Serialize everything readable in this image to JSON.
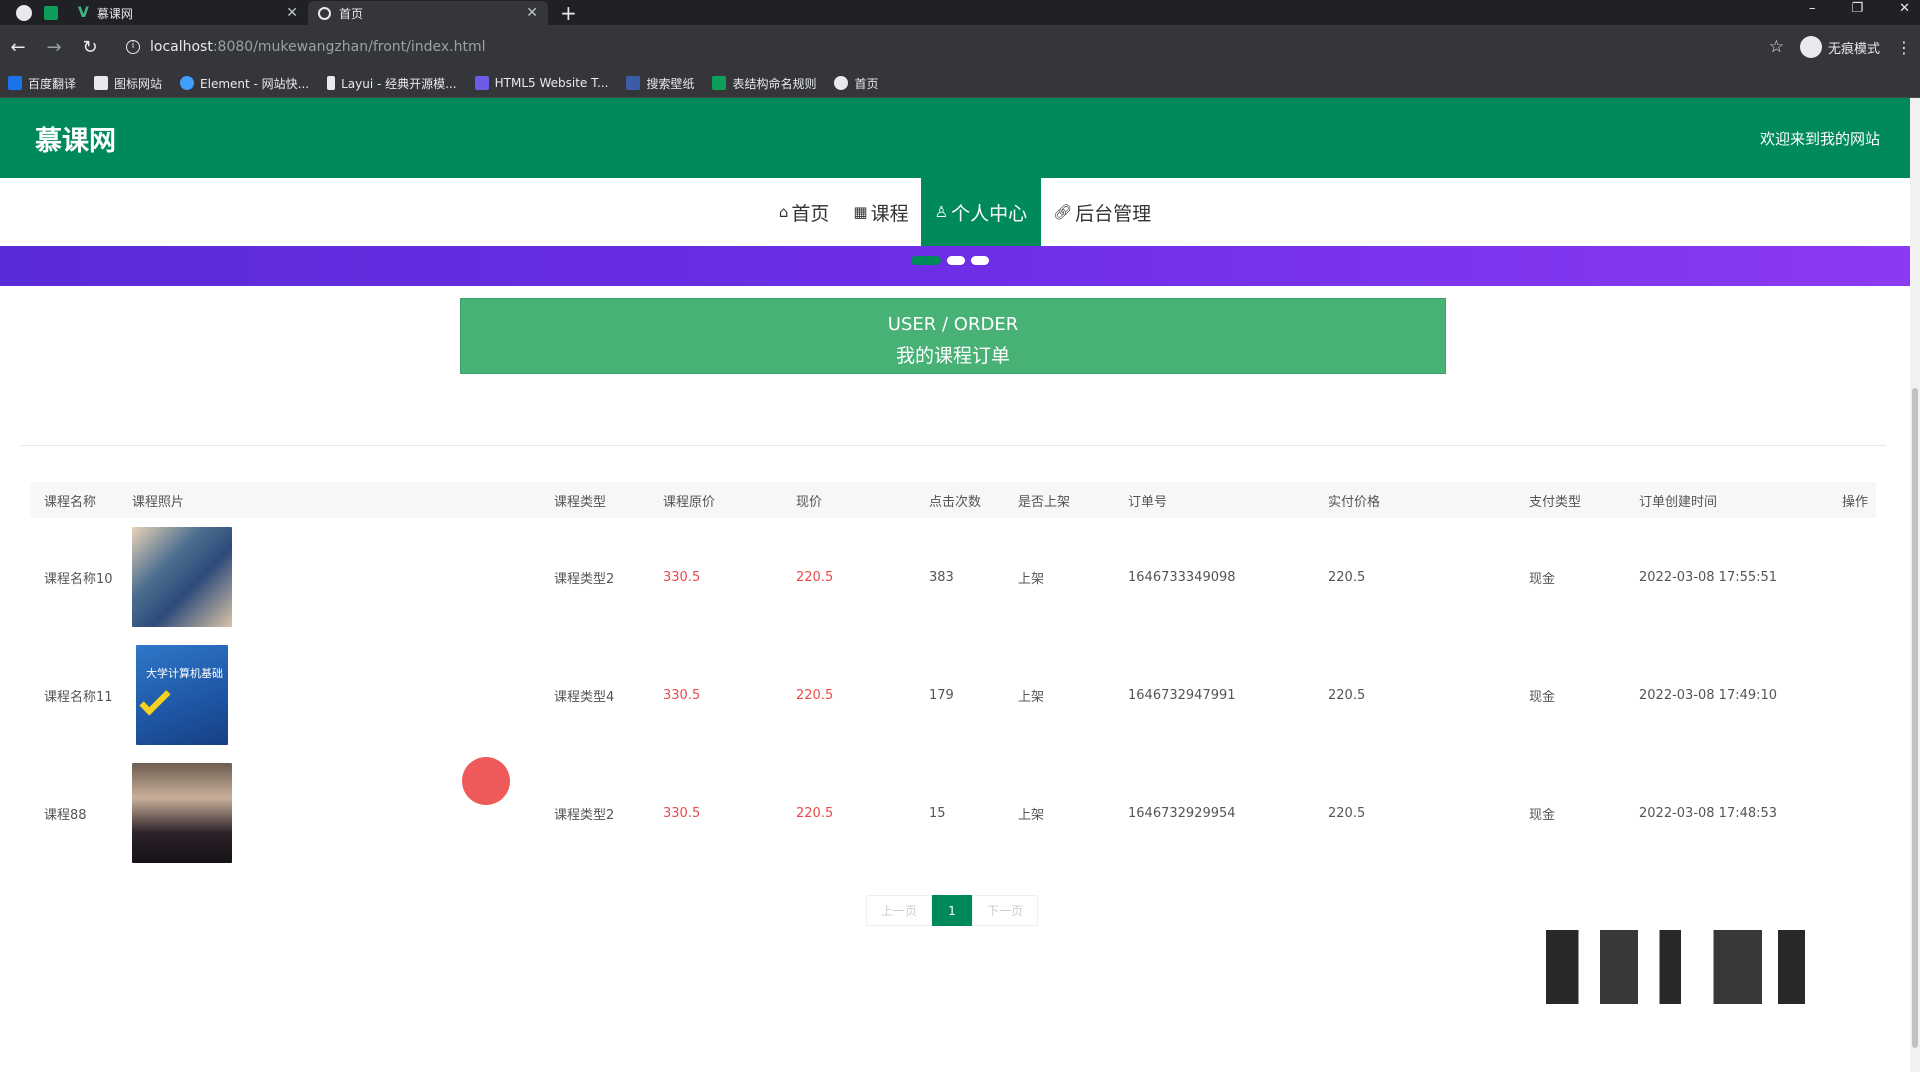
{
  "browser": {
    "tabs": [
      {
        "title": "慕课网",
        "active": false
      },
      {
        "title": "首页",
        "active": true
      }
    ],
    "url_host": "localhost",
    "url_path": ":8080/mukewangzhan/front/index.html",
    "incognito_label": "无痕模式",
    "bookmarks": [
      {
        "label": "百度翻译",
        "color": "#1a73e8"
      },
      {
        "label": "图标网站",
        "color": "#e8eaed"
      },
      {
        "label": "Element - 网站快...",
        "color": "#409eff"
      },
      {
        "label": "Layui - 经典开源模...",
        "color": "#e8eaed"
      },
      {
        "label": "HTML5 Website T...",
        "color": "#6c5ce7"
      },
      {
        "label": "搜索壁纸",
        "color": "#3c5ba9"
      },
      {
        "label": "表结构命名规则",
        "color": "#0c9f5b"
      },
      {
        "label": "首页",
        "color": "#e8eaed"
      }
    ]
  },
  "site": {
    "logo": "慕课网",
    "welcome": "欢迎来到我的网站",
    "nav": [
      {
        "label": "首页",
        "icon": "home-icon",
        "active": false
      },
      {
        "label": "课程",
        "icon": "grid-icon",
        "active": false
      },
      {
        "label": "个人中心",
        "icon": "user-icon",
        "active": true
      },
      {
        "label": "后台管理",
        "icon": "link-icon",
        "active": false
      }
    ]
  },
  "order_banner": {
    "title_en": "USER / ORDER",
    "title_zh": "我的课程订单"
  },
  "table": {
    "headers": [
      "课程名称",
      "课程照片",
      "课程类型",
      "课程原价",
      "现价",
      "点击次数",
      "是否上架",
      "订单号",
      "实付价格",
      "支付类型",
      "订单创建时间",
      "操作"
    ],
    "rows": [
      {
        "name": "课程名称10",
        "type": "课程类型2",
        "orig_price": "330.5",
        "price": "220.5",
        "clicks": "383",
        "listed": "上架",
        "order_no": "1646733349098",
        "paid": "220.5",
        "pay_type": "现金",
        "created": "2022-03-08 17:55:51"
      },
      {
        "name": "课程名称11",
        "type": "课程类型4",
        "orig_price": "330.5",
        "price": "220.5",
        "clicks": "179",
        "listed": "上架",
        "order_no": "1646732947991",
        "paid": "220.5",
        "pay_type": "现金",
        "created": "2022-03-08 17:49:10"
      },
      {
        "name": "课程88",
        "type": "课程类型2",
        "orig_price": "330.5",
        "price": "220.5",
        "clicks": "15",
        "listed": "上架",
        "order_no": "1646732929954",
        "paid": "220.5",
        "pay_type": "现金",
        "created": "2022-03-08 17:48:53"
      }
    ]
  },
  "pagination": {
    "prev": "上一页",
    "current": "1",
    "next": "下一页"
  },
  "book_cover_text": "大学计算机基础",
  "colors": {
    "brand": "#008a5a",
    "banner": "#47b176",
    "price": "#e84b4b"
  }
}
